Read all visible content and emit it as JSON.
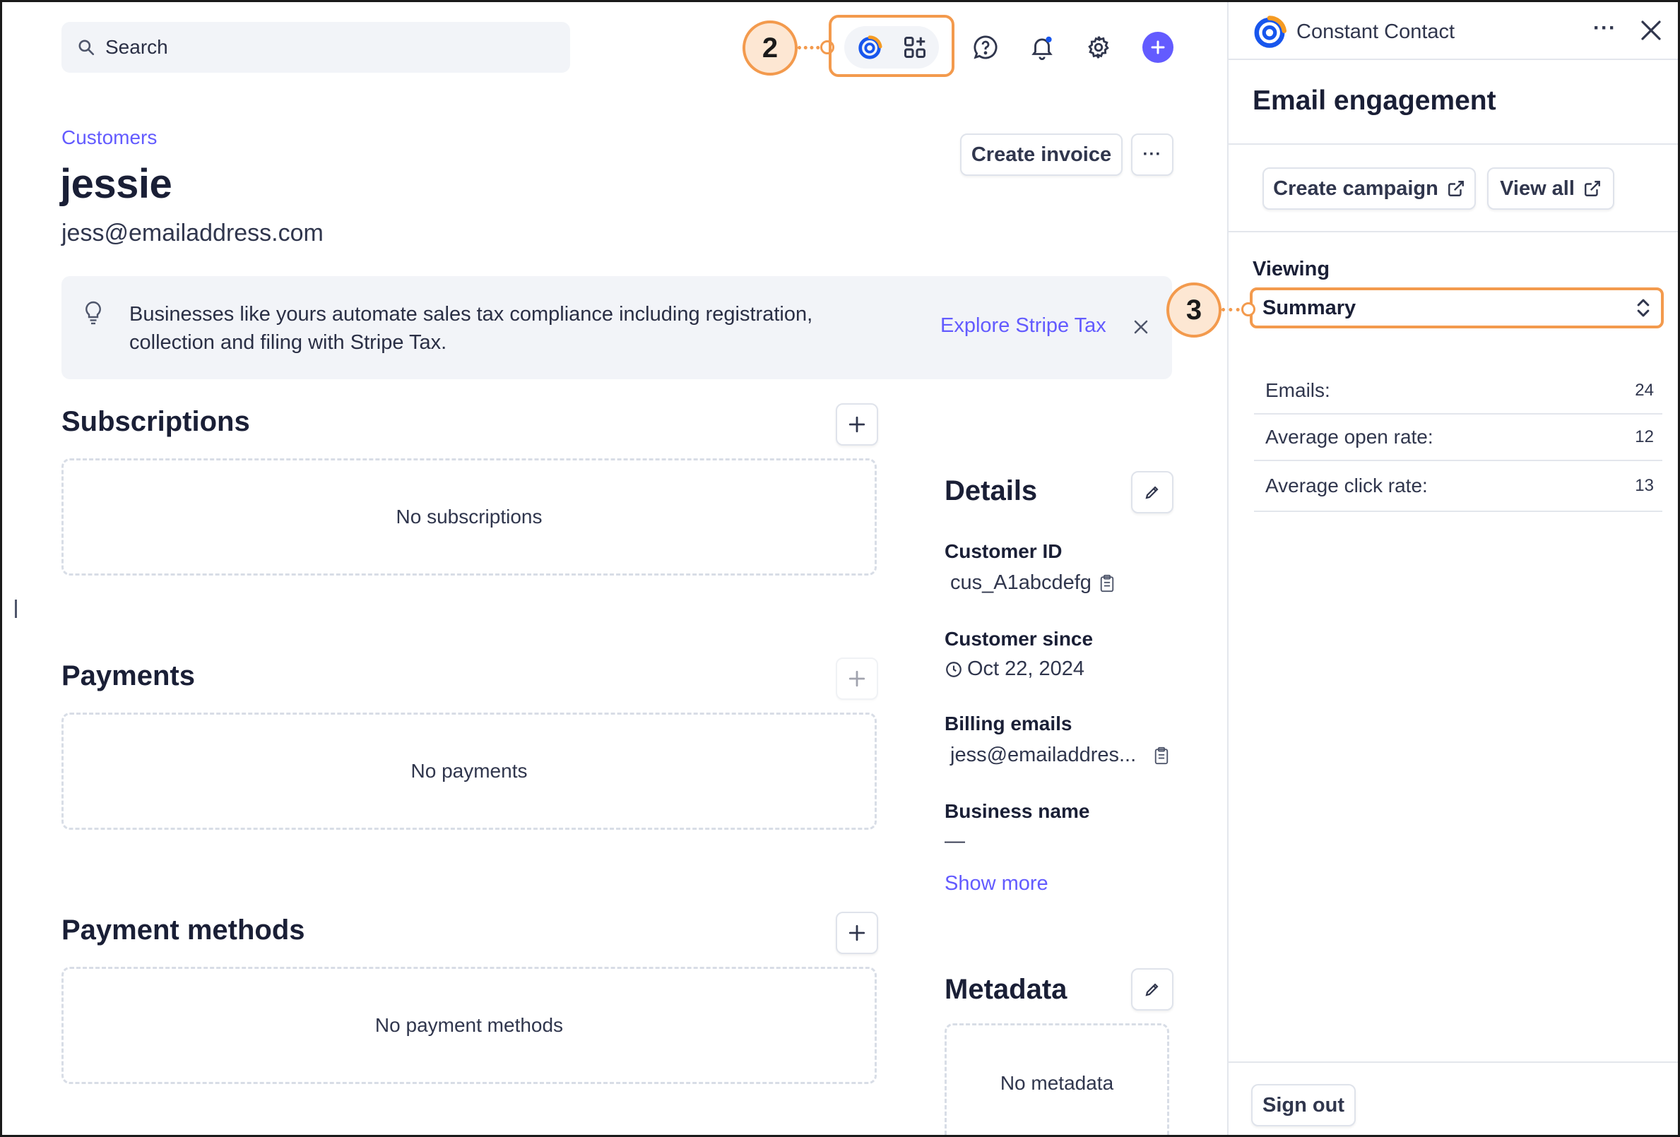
{
  "topbar": {
    "search_placeholder": "Search",
    "callout_apps": "2"
  },
  "header": {
    "breadcrumb": "Customers",
    "title": "jessie",
    "email": "jess@emailaddress.com",
    "create_invoice": "Create invoice",
    "more": "···"
  },
  "banner": {
    "text": "Businesses like yours automate sales tax compliance including registration, collection and filing with Stripe Tax.",
    "link": "Explore Stripe Tax"
  },
  "sections": {
    "subscriptions": {
      "title": "Subscriptions",
      "empty": "No subscriptions"
    },
    "payments": {
      "title": "Payments",
      "empty": "No payments"
    },
    "payment_methods": {
      "title": "Payment methods",
      "empty": "No payment methods"
    }
  },
  "details": {
    "title": "Details",
    "customer_id_label": "Customer ID",
    "customer_id": "cus_A1abcdefg",
    "customer_since_label": "Customer since",
    "customer_since": "Oct 22, 2024",
    "billing_emails_label": "Billing emails",
    "billing_email": "jess@emailaddres...",
    "business_name_label": "Business name",
    "business_name": "—",
    "show_more": "Show more"
  },
  "metadata": {
    "title": "Metadata",
    "empty": "No metadata"
  },
  "panel": {
    "app_name": "Constant Contact",
    "more": "···",
    "heading": "Email engagement",
    "create_campaign": "Create campaign",
    "view_all": "View all",
    "viewing_label": "Viewing",
    "viewing_value": "Summary",
    "callout_viewing": "3",
    "stats": [
      {
        "label": "Emails:",
        "value": "24"
      },
      {
        "label": "Average open rate:",
        "value": "12"
      },
      {
        "label": "Average click rate:",
        "value": "13"
      }
    ],
    "sign_out": "Sign out"
  },
  "colors": {
    "accent": "#635bff",
    "callout": "#f39a4d",
    "brand_blue": "#1856ed",
    "brand_orange": "#f59b23"
  }
}
